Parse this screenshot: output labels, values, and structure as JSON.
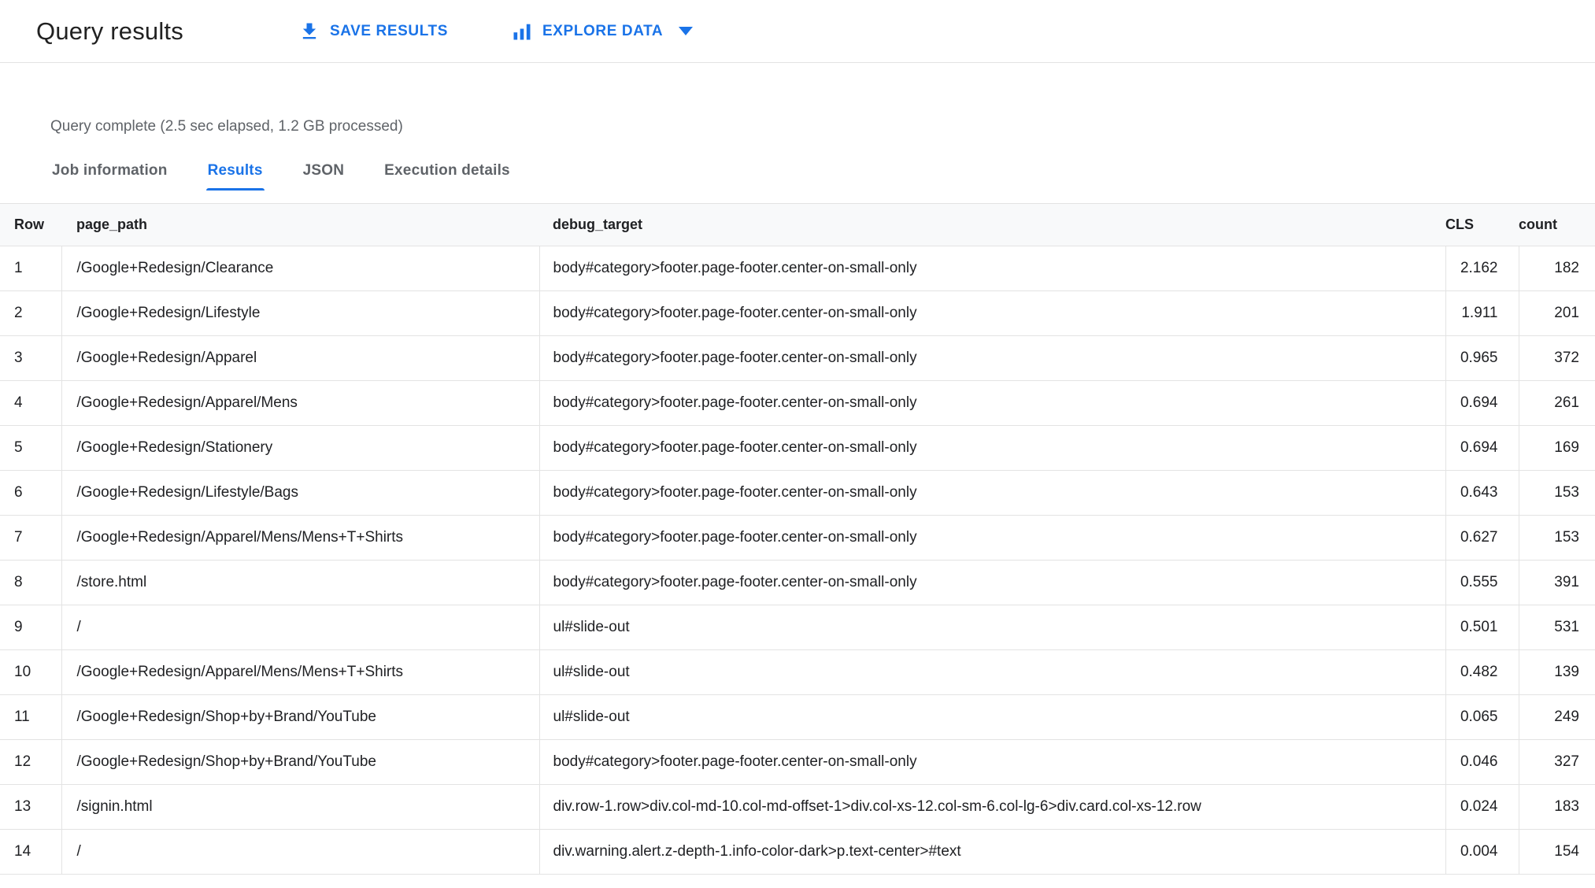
{
  "header": {
    "title": "Query results",
    "save_label": "SAVE RESULTS",
    "explore_label": "EXPLORE DATA"
  },
  "icons": {
    "save": "download-icon",
    "explore": "bar-chart-icon",
    "explore_menu": "caret-down-icon"
  },
  "status": "Query complete (2.5 sec elapsed, 1.2 GB processed)",
  "tabs": [
    {
      "label": "Job information",
      "active": false
    },
    {
      "label": "Results",
      "active": true
    },
    {
      "label": "JSON",
      "active": false
    },
    {
      "label": "Execution details",
      "active": false
    }
  ],
  "table": {
    "columns": [
      "Row",
      "page_path",
      "debug_target",
      "CLS",
      "count"
    ],
    "rows": [
      {
        "row": "1",
        "page_path": "/Google+Redesign/Clearance",
        "debug_target": "body#category>footer.page-footer.center-on-small-only",
        "cls": "2.162",
        "count": "182"
      },
      {
        "row": "2",
        "page_path": "/Google+Redesign/Lifestyle",
        "debug_target": "body#category>footer.page-footer.center-on-small-only",
        "cls": "1.911",
        "count": "201"
      },
      {
        "row": "3",
        "page_path": "/Google+Redesign/Apparel",
        "debug_target": "body#category>footer.page-footer.center-on-small-only",
        "cls": "0.965",
        "count": "372"
      },
      {
        "row": "4",
        "page_path": "/Google+Redesign/Apparel/Mens",
        "debug_target": "body#category>footer.page-footer.center-on-small-only",
        "cls": "0.694",
        "count": "261"
      },
      {
        "row": "5",
        "page_path": "/Google+Redesign/Stationery",
        "debug_target": "body#category>footer.page-footer.center-on-small-only",
        "cls": "0.694",
        "count": "169"
      },
      {
        "row": "6",
        "page_path": "/Google+Redesign/Lifestyle/Bags",
        "debug_target": "body#category>footer.page-footer.center-on-small-only",
        "cls": "0.643",
        "count": "153"
      },
      {
        "row": "7",
        "page_path": "/Google+Redesign/Apparel/Mens/Mens+T+Shirts",
        "debug_target": "body#category>footer.page-footer.center-on-small-only",
        "cls": "0.627",
        "count": "153"
      },
      {
        "row": "8",
        "page_path": "/store.html",
        "debug_target": "body#category>footer.page-footer.center-on-small-only",
        "cls": "0.555",
        "count": "391"
      },
      {
        "row": "9",
        "page_path": "/",
        "debug_target": "ul#slide-out",
        "cls": "0.501",
        "count": "531"
      },
      {
        "row": "10",
        "page_path": "/Google+Redesign/Apparel/Mens/Mens+T+Shirts",
        "debug_target": "ul#slide-out",
        "cls": "0.482",
        "count": "139"
      },
      {
        "row": "11",
        "page_path": "/Google+Redesign/Shop+by+Brand/YouTube",
        "debug_target": "ul#slide-out",
        "cls": "0.065",
        "count": "249"
      },
      {
        "row": "12",
        "page_path": "/Google+Redesign/Shop+by+Brand/YouTube",
        "debug_target": "body#category>footer.page-footer.center-on-small-only",
        "cls": "0.046",
        "count": "327"
      },
      {
        "row": "13",
        "page_path": "/signin.html",
        "debug_target": "div.row-1.row>div.col-md-10.col-md-offset-1>div.col-xs-12.col-sm-6.col-lg-6>div.card.col-xs-12.row",
        "cls": "0.024",
        "count": "183"
      },
      {
        "row": "14",
        "page_path": "/",
        "debug_target": "div.warning.alert.z-depth-1.info-color-dark>p.text-center>#text",
        "cls": "0.004",
        "count": "154"
      }
    ]
  },
  "colors": {
    "accent": "#1a73e8",
    "text": "#202124",
    "muted": "#5f6368",
    "border": "#e3e3e3",
    "table_header_bg": "#f8f9fa"
  }
}
